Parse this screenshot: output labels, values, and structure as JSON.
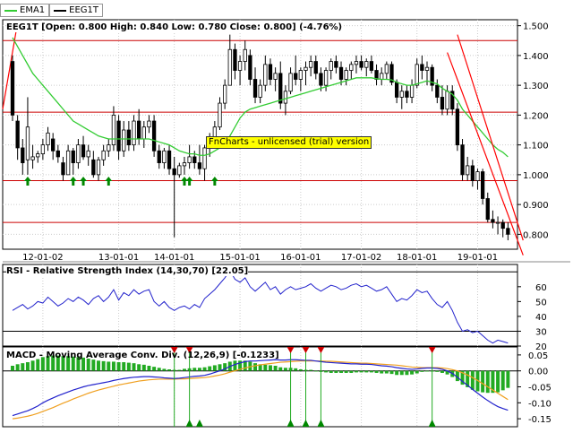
{
  "legend": [
    {
      "label": "EMA1",
      "color": "#33cc33"
    },
    {
      "label": "EEG1T",
      "color": "#000000"
    }
  ],
  "panels": {
    "price_title": "EEG1T [Open: 0.800  High: 0.840  Low: 0.780  Close: 0.800] (-4.76%)",
    "rsi_title": "RSI - Relative Strength Index (14,30,70) [22.05]",
    "macd_title": "MACD - Moving Average Conv. Div. (12,26,9) [-0.1233]",
    "watermark": "FnCharts - unlicensed (trial) version"
  },
  "colors": {
    "candle_up": "#ffffff",
    "candle_down": "#000000",
    "ema": "#33cc33",
    "level_line": "#cc0000",
    "trend_line": "#ff0000",
    "buy_arrow": "#008800",
    "rsi_line": "#2222cc",
    "macd_line": "#2222cc",
    "signal_line": "#f0a020",
    "histogram": "#22aa22",
    "sell_marker": "#cc0000"
  },
  "chart_data": [
    {
      "type": "candlestick",
      "x_ticks": [
        "12-01-02",
        "13-01-01",
        "14-01-01",
        "15-01-01",
        "16-01-01",
        "17-01-02",
        "18-01-01",
        "19-01-01"
      ],
      "ylim": [
        0.75,
        1.52
      ],
      "y_ticks": [
        "1.500",
        "1.400",
        "1.300",
        "1.200",
        "1.100",
        "1.000",
        "0.900",
        "0.800"
      ],
      "candles": [
        [
          1.38,
          1.4,
          1.18,
          1.2
        ],
        [
          1.18,
          1.2,
          1.05,
          1.09
        ],
        [
          1.09,
          1.12,
          1.0,
          1.04
        ],
        [
          1.05,
          1.26,
          1.0,
          1.16
        ],
        [
          1.05,
          1.1,
          1.02,
          1.06
        ],
        [
          1.06,
          1.08,
          1.04,
          1.07
        ],
        [
          1.07,
          1.12,
          1.05,
          1.1
        ],
        [
          1.1,
          1.16,
          1.08,
          1.14
        ],
        [
          1.12,
          1.14,
          1.05,
          1.08
        ],
        [
          1.08,
          1.1,
          1.04,
          1.06
        ],
        [
          1.04,
          1.06,
          0.98,
          1.0
        ],
        [
          1.0,
          1.1,
          1.0,
          1.08
        ],
        [
          1.08,
          1.09,
          1.0,
          1.04
        ],
        [
          1.04,
          1.12,
          1.02,
          1.1
        ],
        [
          1.1,
          1.13,
          1.05,
          1.06
        ],
        [
          1.06,
          1.1,
          1.03,
          1.08
        ],
        [
          1.05,
          1.08,
          0.99,
          1.0
        ],
        [
          1.0,
          1.06,
          0.98,
          1.05
        ],
        [
          1.05,
          1.1,
          1.03,
          1.08
        ],
        [
          1.08,
          1.12,
          1.06,
          1.1
        ],
        [
          1.1,
          1.23,
          1.08,
          1.2
        ],
        [
          1.18,
          1.2,
          1.05,
          1.08
        ],
        [
          1.08,
          1.18,
          1.06,
          1.15
        ],
        [
          1.15,
          1.18,
          1.08,
          1.1
        ],
        [
          1.1,
          1.2,
          1.08,
          1.18
        ],
        [
          1.18,
          1.22,
          1.1,
          1.12
        ],
        [
          1.12,
          1.18,
          1.09,
          1.16
        ],
        [
          1.16,
          1.2,
          1.14,
          1.18
        ],
        [
          1.18,
          1.2,
          1.06,
          1.08
        ],
        [
          1.08,
          1.1,
          1.02,
          1.04
        ],
        [
          1.04,
          1.09,
          1.02,
          1.08
        ],
        [
          1.08,
          1.1,
          1.0,
          1.02
        ],
        [
          1.02,
          1.06,
          0.79,
          1.0
        ],
        [
          1.0,
          1.04,
          0.99,
          1.03
        ],
        [
          1.03,
          1.06,
          1.0,
          1.04
        ],
        [
          1.04,
          1.1,
          1.02,
          1.06
        ],
        [
          1.06,
          1.08,
          1.02,
          1.04
        ],
        [
          1.04,
          1.1,
          1.0,
          1.02
        ],
        [
          1.02,
          1.1,
          0.98,
          1.09
        ],
        [
          1.09,
          1.14,
          1.06,
          1.12
        ],
        [
          1.12,
          1.18,
          1.1,
          1.16
        ],
        [
          1.16,
          1.26,
          1.15,
          1.24
        ],
        [
          1.24,
          1.32,
          1.22,
          1.3
        ],
        [
          1.3,
          1.47,
          1.3,
          1.42
        ],
        [
          1.42,
          1.44,
          1.32,
          1.35
        ],
        [
          1.35,
          1.4,
          1.3,
          1.38
        ],
        [
          1.38,
          1.45,
          1.35,
          1.42
        ],
        [
          1.4,
          1.42,
          1.3,
          1.32
        ],
        [
          1.32,
          1.36,
          1.24,
          1.26
        ],
        [
          1.26,
          1.32,
          1.24,
          1.3
        ],
        [
          1.3,
          1.4,
          1.28,
          1.37
        ],
        [
          1.37,
          1.39,
          1.3,
          1.32
        ],
        [
          1.32,
          1.36,
          1.28,
          1.34
        ],
        [
          1.34,
          1.38,
          1.22,
          1.24
        ],
        [
          1.24,
          1.3,
          1.2,
          1.28
        ],
        [
          1.28,
          1.36,
          1.27,
          1.34
        ],
        [
          1.34,
          1.4,
          1.3,
          1.32
        ],
        [
          1.32,
          1.36,
          1.28,
          1.35
        ],
        [
          1.35,
          1.38,
          1.3,
          1.36
        ],
        [
          1.36,
          1.4,
          1.33,
          1.38
        ],
        [
          1.38,
          1.4,
          1.32,
          1.34
        ],
        [
          1.34,
          1.36,
          1.28,
          1.3
        ],
        [
          1.3,
          1.36,
          1.28,
          1.35
        ],
        [
          1.35,
          1.39,
          1.32,
          1.38
        ],
        [
          1.38,
          1.4,
          1.34,
          1.36
        ],
        [
          1.36,
          1.38,
          1.3,
          1.32
        ],
        [
          1.32,
          1.36,
          1.3,
          1.35
        ],
        [
          1.35,
          1.38,
          1.32,
          1.37
        ],
        [
          1.37,
          1.4,
          1.34,
          1.38
        ],
        [
          1.38,
          1.4,
          1.35,
          1.36
        ],
        [
          1.36,
          1.39,
          1.33,
          1.38
        ],
        [
          1.38,
          1.4,
          1.34,
          1.35
        ],
        [
          1.35,
          1.37,
          1.3,
          1.32
        ],
        [
          1.32,
          1.36,
          1.3,
          1.34
        ],
        [
          1.34,
          1.38,
          1.32,
          1.37
        ],
        [
          1.37,
          1.38,
          1.3,
          1.31
        ],
        [
          1.31,
          1.32,
          1.24,
          1.26
        ],
        [
          1.26,
          1.3,
          1.22,
          1.28
        ],
        [
          1.28,
          1.3,
          1.24,
          1.26
        ],
        [
          1.26,
          1.32,
          1.24,
          1.3
        ],
        [
          1.3,
          1.39,
          1.29,
          1.37
        ],
        [
          1.37,
          1.4,
          1.32,
          1.35
        ],
        [
          1.35,
          1.38,
          1.3,
          1.36
        ],
        [
          1.36,
          1.37,
          1.28,
          1.3
        ],
        [
          1.3,
          1.32,
          1.24,
          1.26
        ],
        [
          1.26,
          1.3,
          1.2,
          1.22
        ],
        [
          1.22,
          1.3,
          1.2,
          1.28
        ],
        [
          1.28,
          1.3,
          1.2,
          1.22
        ],
        [
          1.22,
          1.24,
          1.08,
          1.1
        ],
        [
          1.1,
          1.12,
          0.98,
          1.0
        ],
        [
          1.0,
          1.06,
          0.98,
          1.03
        ],
        [
          1.03,
          1.05,
          0.96,
          0.98
        ],
        [
          0.98,
          1.02,
          0.95,
          1.01
        ],
        [
          1.01,
          1.02,
          0.9,
          0.92
        ],
        [
          0.92,
          0.94,
          0.84,
          0.85
        ],
        [
          0.85,
          0.88,
          0.82,
          0.84
        ],
        [
          0.84,
          0.86,
          0.8,
          0.84
        ],
        [
          0.84,
          0.85,
          0.79,
          0.82
        ],
        [
          0.82,
          0.84,
          0.78,
          0.8
        ]
      ],
      "ema": [
        1.46,
        1.43,
        1.4,
        1.37,
        1.34,
        1.32,
        1.3,
        1.28,
        1.26,
        1.24,
        1.22,
        1.2,
        1.18,
        1.17,
        1.16,
        1.15,
        1.14,
        1.13,
        1.125,
        1.12,
        1.12,
        1.12,
        1.12,
        1.12,
        1.12,
        1.12,
        1.12,
        1.12,
        1.115,
        1.11,
        1.105,
        1.1,
        1.09,
        1.08,
        1.075,
        1.07,
        1.07,
        1.065,
        1.065,
        1.07,
        1.08,
        1.09,
        1.1,
        1.13,
        1.16,
        1.19,
        1.21,
        1.22,
        1.225,
        1.23,
        1.235,
        1.24,
        1.245,
        1.25,
        1.255,
        1.26,
        1.265,
        1.27,
        1.275,
        1.28,
        1.285,
        1.29,
        1.295,
        1.3,
        1.305,
        1.31,
        1.315,
        1.32,
        1.325,
        1.325,
        1.325,
        1.325,
        1.322,
        1.32,
        1.32,
        1.318,
        1.31,
        1.305,
        1.3,
        1.3,
        1.305,
        1.31,
        1.315,
        1.31,
        1.305,
        1.29,
        1.28,
        1.27,
        1.25,
        1.22,
        1.2,
        1.18,
        1.16,
        1.14,
        1.12,
        1.1,
        1.085,
        1.075,
        1.06
      ],
      "horizontal_levels": [
        1.45,
        1.21,
        0.98,
        0.84
      ],
      "buy_signal_candles": [
        3,
        12,
        14,
        19,
        34,
        35,
        40
      ],
      "trend_lines": [
        {
          "from": [
            88,
            1.47
          ],
          "to": [
            101,
            0.78
          ]
        },
        {
          "from": [
            86,
            1.41
          ],
          "to": [
            101,
            0.73
          ]
        }
      ]
    },
    {
      "type": "line",
      "title": "RSI - Relative Strength Index (14,30,70) [22.05]",
      "ylim": [
        20,
        75
      ],
      "y_ticks": [
        "60",
        "50",
        "40",
        "30",
        "20"
      ],
      "reference_lines": [
        70,
        30
      ],
      "values": [
        44,
        46,
        48,
        45,
        47,
        50,
        49,
        53,
        50,
        47,
        49,
        52,
        50,
        53,
        51,
        48,
        52,
        54,
        50,
        53,
        58,
        51,
        56,
        54,
        58,
        55,
        57,
        58,
        50,
        47,
        50,
        46,
        44,
        46,
        47,
        45,
        48,
        46,
        52,
        55,
        58,
        62,
        66,
        71,
        65,
        63,
        66,
        60,
        57,
        60,
        63,
        58,
        60,
        55,
        58,
        60,
        58,
        59,
        60,
        62,
        59,
        57,
        59,
        61,
        60,
        58,
        59,
        61,
        62,
        60,
        61,
        59,
        57,
        58,
        60,
        55,
        50,
        52,
        51,
        54,
        58,
        56,
        57,
        52,
        48,
        46,
        50,
        44,
        36,
        30,
        31,
        29,
        30,
        27,
        24,
        22,
        24,
        23,
        22.05
      ]
    },
    {
      "type": "line",
      "title": "MACD - Moving Average Conv. Div. (12,26,9) [-0.1233]",
      "ylim": [
        -0.175,
        0.075
      ],
      "y_ticks": [
        "0.05",
        "0.00",
        "-0.05",
        "-0.10",
        "-0.15"
      ],
      "macd": [
        -0.14,
        -0.135,
        -0.13,
        -0.125,
        -0.118,
        -0.11,
        -0.1,
        -0.092,
        -0.085,
        -0.078,
        -0.072,
        -0.066,
        -0.06,
        -0.055,
        -0.05,
        -0.046,
        -0.043,
        -0.04,
        -0.037,
        -0.034,
        -0.03,
        -0.027,
        -0.024,
        -0.022,
        -0.02,
        -0.019,
        -0.018,
        -0.018,
        -0.019,
        -0.02,
        -0.022,
        -0.023,
        -0.024,
        -0.023,
        -0.021,
        -0.019,
        -0.017,
        -0.016,
        -0.014,
        -0.01,
        -0.005,
        0.0,
        0.006,
        0.014,
        0.02,
        0.025,
        0.029,
        0.031,
        0.031,
        0.032,
        0.033,
        0.034,
        0.035,
        0.034,
        0.034,
        0.035,
        0.035,
        0.034,
        0.033,
        0.033,
        0.031,
        0.029,
        0.027,
        0.026,
        0.025,
        0.024,
        0.023,
        0.022,
        0.022,
        0.021,
        0.021,
        0.02,
        0.018,
        0.016,
        0.015,
        0.013,
        0.01,
        0.008,
        0.006,
        0.005,
        0.006,
        0.008,
        0.009,
        0.009,
        0.008,
        0.005,
        0.0,
        -0.008,
        -0.02,
        -0.033,
        -0.045,
        -0.058,
        -0.07,
        -0.082,
        -0.093,
        -0.103,
        -0.112,
        -0.118,
        -0.1233
      ],
      "signal": [
        -0.15,
        -0.148,
        -0.145,
        -0.142,
        -0.138,
        -0.133,
        -0.127,
        -0.121,
        -0.115,
        -0.108,
        -0.101,
        -0.095,
        -0.088,
        -0.082,
        -0.076,
        -0.07,
        -0.065,
        -0.06,
        -0.056,
        -0.052,
        -0.048,
        -0.044,
        -0.041,
        -0.038,
        -0.035,
        -0.032,
        -0.03,
        -0.028,
        -0.027,
        -0.026,
        -0.026,
        -0.026,
        -0.026,
        -0.025,
        -0.025,
        -0.024,
        -0.023,
        -0.022,
        -0.021,
        -0.019,
        -0.016,
        -0.013,
        -0.009,
        -0.004,
        0.0,
        0.005,
        0.009,
        0.013,
        0.016,
        0.019,
        0.021,
        0.023,
        0.025,
        0.027,
        0.028,
        0.029,
        0.03,
        0.031,
        0.031,
        0.031,
        0.031,
        0.031,
        0.03,
        0.03,
        0.029,
        0.028,
        0.027,
        0.026,
        0.025,
        0.024,
        0.024,
        0.023,
        0.022,
        0.021,
        0.02,
        0.019,
        0.018,
        0.016,
        0.014,
        0.012,
        0.011,
        0.01,
        0.01,
        0.01,
        0.01,
        0.009,
        0.007,
        0.004,
        0.0,
        -0.006,
        -0.013,
        -0.021,
        -0.03,
        -0.04,
        -0.05,
        -0.06,
        -0.07,
        -0.08,
        -0.09
      ],
      "sell_signal_candles": [
        32,
        35,
        55,
        58,
        61,
        83
      ],
      "buy_signal_candles": [
        35,
        37,
        55,
        58,
        61,
        83
      ]
    }
  ]
}
